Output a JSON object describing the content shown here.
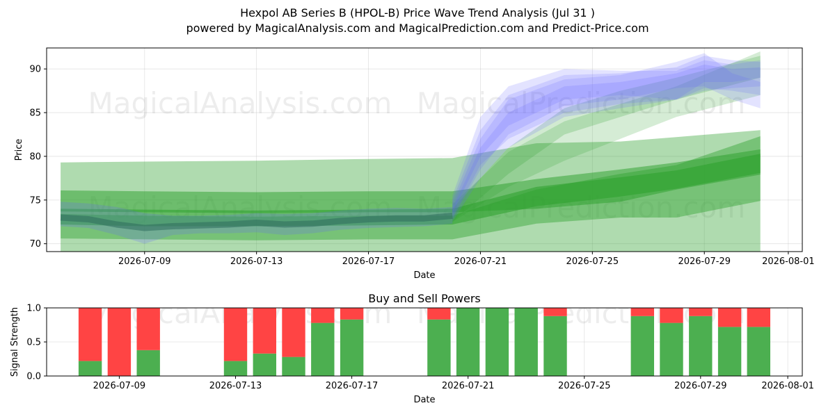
{
  "title": "Hexpol AB Series B (HPOL-B) Price Wave Trend Analysis (Jul 31 )",
  "subtitle": "powered by MagicalAnalysis.com and MagicalPrediction.com and Predict-Price.com",
  "watermarks": [
    "MagicalAnalysis.com",
    "MagicalPrediction.com"
  ],
  "colors": {
    "green_band": "#2ca02c",
    "blue_band": "#6666ff",
    "buy": "#4caf50",
    "sell": "#ff4444",
    "dark_line": "#2e6b5c"
  },
  "chart_data": [
    {
      "type": "area",
      "title": "",
      "xlabel": "Date",
      "ylabel": "Price",
      "xlim": [
        "2026-07-05T12:00",
        "2026-08-01T12:00"
      ],
      "ylim": [
        69.1,
        92.4
      ],
      "x_ticks": [
        "2026-07-09",
        "2026-07-13",
        "2026-07-17",
        "2026-07-21",
        "2026-07-25",
        "2026-07-29",
        "2026-08-01"
      ],
      "y_ticks": [
        70,
        75,
        80,
        85,
        90
      ],
      "grid": true,
      "green_bands": [
        {
          "x": [
            "2026-07-06",
            "2026-07-09",
            "2026-07-13",
            "2026-07-17",
            "2026-07-20",
            "2026-07-23",
            "2026-07-26",
            "2026-07-28",
            "2026-07-31"
          ],
          "upper": [
            79.3,
            79.4,
            79.5,
            79.7,
            79.8,
            81.5,
            81.7,
            82.2,
            83.0
          ],
          "lower": [
            69.0,
            69.0,
            69.0,
            69.0,
            69.0,
            68.0,
            68.0,
            68.0,
            68.0
          ]
        },
        {
          "x": [
            "2026-07-06",
            "2026-07-09",
            "2026-07-13",
            "2026-07-17",
            "2026-07-20",
            "2026-07-23",
            "2026-07-26",
            "2026-07-28",
            "2026-07-31"
          ],
          "upper": [
            76.1,
            76.0,
            75.9,
            76.0,
            76.0,
            77.4,
            78.5,
            79.3,
            80.8
          ],
          "lower": [
            73.7,
            73.6,
            73.5,
            73.6,
            73.6,
            74.0,
            74.8,
            76.2,
            77.9
          ]
        },
        {
          "x": [
            "2026-07-06",
            "2026-07-09",
            "2026-07-13",
            "2026-07-17",
            "2026-07-20",
            "2026-07-23",
            "2026-07-26",
            "2026-07-28",
            "2026-07-31"
          ],
          "upper": [
            73.4,
            73.2,
            73.1,
            73.2,
            73.2,
            76.2,
            78.0,
            79.0,
            82.3
          ],
          "lower": [
            70.6,
            70.5,
            70.4,
            70.5,
            70.5,
            72.3,
            73.0,
            73.0,
            74.9
          ]
        },
        {
          "x": [
            "2026-07-06",
            "2026-07-09",
            "2026-07-13",
            "2026-07-17",
            "2026-07-20",
            "2026-07-23",
            "2026-07-26",
            "2026-07-28",
            "2026-07-31"
          ],
          "upper": [
            74.0,
            73.9,
            73.8,
            73.9,
            74.0,
            76.5,
            77.6,
            78.4,
            80.3
          ],
          "lower": [
            72.2,
            72.0,
            72.0,
            72.1,
            72.2,
            74.3,
            75.4,
            76.3,
            78.1
          ]
        },
        {
          "x": [
            "2026-07-20",
            "2026-07-22",
            "2026-07-24",
            "2026-07-26",
            "2026-07-28",
            "2026-07-31"
          ],
          "upper": [
            74.5,
            80.5,
            84.0,
            86.0,
            88.0,
            92.0
          ],
          "lower": [
            72.5,
            76.5,
            79.5,
            82.0,
            84.5,
            87.0
          ]
        },
        {
          "x": [
            "2026-07-20",
            "2026-07-22",
            "2026-07-24",
            "2026-07-26",
            "2026-07-28",
            "2026-07-31"
          ],
          "upper": [
            74.0,
            81.0,
            85.5,
            87.5,
            89.0,
            91.5
          ],
          "lower": [
            72.5,
            78.0,
            82.5,
            84.5,
            86.5,
            89.0
          ]
        }
      ],
      "blue_bands": [
        {
          "x": [
            "2026-07-20",
            "2026-07-21",
            "2026-07-22",
            "2026-07-24",
            "2026-07-26",
            "2026-07-28",
            "2026-07-29",
            "2026-07-30",
            "2026-07-31"
          ],
          "upper": [
            75.0,
            83.0,
            87.0,
            89.3,
            89.5,
            90.2,
            91.5,
            91.0,
            90.8
          ],
          "lower": [
            73.0,
            79.0,
            82.0,
            85.0,
            86.0,
            86.5,
            87.8,
            87.5,
            87.0
          ]
        },
        {
          "x": [
            "2026-07-20",
            "2026-07-21",
            "2026-07-22",
            "2026-07-24",
            "2026-07-26",
            "2026-07-28",
            "2026-07-29",
            "2026-07-30",
            "2026-07-31"
          ],
          "upper": [
            74.5,
            82.0,
            86.5,
            88.8,
            89.3,
            90.8,
            91.8,
            89.5,
            88.5
          ],
          "lower": [
            72.8,
            78.5,
            82.5,
            85.8,
            86.5,
            87.8,
            88.0,
            86.5,
            85.5
          ]
        },
        {
          "x": [
            "2026-07-20",
            "2026-07-21",
            "2026-07-22",
            "2026-07-24",
            "2026-07-26",
            "2026-07-28",
            "2026-07-29",
            "2026-07-30",
            "2026-07-31"
          ],
          "upper": [
            75.5,
            84.5,
            88.0,
            90.0,
            89.8,
            89.8,
            91.0,
            90.5,
            91.0
          ],
          "lower": [
            73.5,
            80.0,
            83.5,
            86.5,
            87.0,
            86.5,
            88.5,
            88.5,
            89.0
          ]
        },
        {
          "x": [
            "2026-07-20",
            "2026-07-21",
            "2026-07-22",
            "2026-07-24",
            "2026-07-26",
            "2026-07-28",
            "2026-07-29",
            "2026-07-30",
            "2026-07-31"
          ],
          "upper": [
            74.0,
            81.0,
            85.0,
            88.0,
            88.5,
            89.5,
            90.5,
            90.0,
            90.2
          ],
          "lower": [
            72.5,
            77.5,
            81.0,
            84.5,
            85.5,
            86.5,
            87.5,
            87.8,
            88.0
          ]
        }
      ],
      "history": {
        "x": [
          "2026-07-06",
          "2026-07-07",
          "2026-07-08",
          "2026-07-09",
          "2026-07-10",
          "2026-07-11",
          "2026-07-12",
          "2026-07-13",
          "2026-07-14",
          "2026-07-15",
          "2026-07-16",
          "2026-07-17",
          "2026-07-18",
          "2026-07-19",
          "2026-07-20"
        ],
        "upper": [
          74.8,
          74.6,
          74.2,
          73.5,
          73.2,
          73.2,
          73.3,
          73.5,
          73.4,
          73.5,
          73.8,
          74.0,
          74.1,
          74.0,
          74.2
        ],
        "lower": [
          72.0,
          71.8,
          71.0,
          70.0,
          71.0,
          71.2,
          71.2,
          71.3,
          71.0,
          71.2,
          71.6,
          71.8,
          71.9,
          72.0,
          72.3
        ],
        "mid": [
          73.0,
          72.8,
          72.2,
          71.8,
          72.0,
          72.1,
          72.2,
          72.4,
          72.2,
          72.3,
          72.6,
          72.8,
          72.9,
          72.9,
          73.2
        ]
      }
    },
    {
      "type": "bar",
      "title": "Buy and Sell Powers",
      "xlabel": "Date",
      "ylabel": "Signal Strength",
      "xlim": [
        "2026-07-06T12:00",
        "2026-08-01T12:00"
      ],
      "ylim": [
        0,
        1
      ],
      "x_ticks": [
        "2026-07-09",
        "2026-07-13",
        "2026-07-17",
        "2026-07-21",
        "2026-07-25",
        "2026-07-29",
        "2026-08-01"
      ],
      "y_ticks": [
        0.0,
        0.5,
        1.0
      ],
      "grid": true,
      "dates": [
        "2026-07-08",
        "2026-07-09",
        "2026-07-10",
        "2026-07-13",
        "2026-07-14",
        "2026-07-15",
        "2026-07-16",
        "2026-07-17",
        "2026-07-20",
        "2026-07-21",
        "2026-07-22",
        "2026-07-23",
        "2026-07-24",
        "2026-07-27",
        "2026-07-28",
        "2026-07-29",
        "2026-07-30",
        "2026-07-31"
      ],
      "buy": [
        0.22,
        0.0,
        0.38,
        0.22,
        0.33,
        0.28,
        0.78,
        0.83,
        0.83,
        1.0,
        1.0,
        1.0,
        0.88,
        0.88,
        0.78,
        0.88,
        0.72,
        0.72
      ],
      "sell": [
        0.78,
        1.0,
        0.62,
        0.78,
        0.67,
        0.72,
        0.22,
        0.17,
        0.17,
        0.0,
        0.0,
        0.0,
        0.12,
        0.12,
        0.22,
        0.12,
        0.28,
        0.28
      ]
    }
  ]
}
